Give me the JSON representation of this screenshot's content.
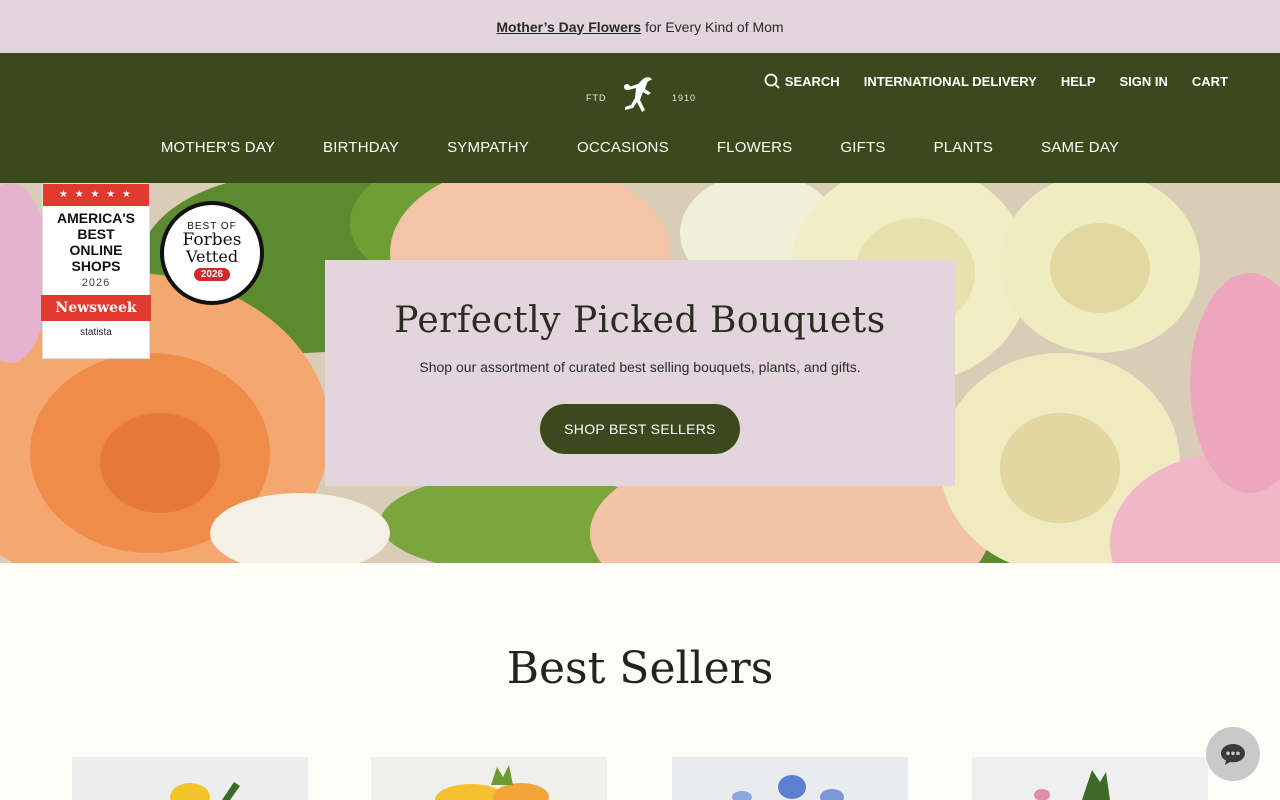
{
  "promo": {
    "link": "Mother’s Day Flowers",
    "rest": "for Every Kind of Mom"
  },
  "header": {
    "logo": {
      "left": "FTD",
      "right": "1910"
    },
    "utility": [
      {
        "label": "SEARCH",
        "icon": "search-icon"
      },
      {
        "label": "INTERNATIONAL DELIVERY"
      },
      {
        "label": "HELP"
      },
      {
        "label": "SIGN IN"
      },
      {
        "label": "CART"
      }
    ],
    "nav": [
      "MOTHER'S DAY",
      "BIRTHDAY",
      "SYMPATHY",
      "OCCASIONS",
      "FLOWERS",
      "GIFTS",
      "PLANTS",
      "SAME DAY"
    ]
  },
  "hero": {
    "title": "Perfectly Picked Bouquets",
    "subtitle": "Shop our assortment of curated best selling bouquets, plants, and gifts.",
    "button": "SHOP BEST SELLERS",
    "badges": {
      "newsweek": {
        "stars": "★ ★ ★ ★ ★",
        "headline": "AMERICA'S BEST ONLINE SHOPS",
        "year": "2026",
        "brand": "Newsweek",
        "powered": "statista"
      },
      "forbes": {
        "best": "BEST OF",
        "name": "Forbes",
        "vetted": "Vetted",
        "year": "2026"
      }
    }
  },
  "best_sellers": {
    "title": "Best Sellers"
  },
  "colors": {
    "promo_bg": "#e3d5dc",
    "header_bg": "#3a4a1c",
    "card_bg": "#e3d5dc",
    "page_bg": "#fdfcf7"
  },
  "chat": {
    "icon": "chat-icon"
  }
}
